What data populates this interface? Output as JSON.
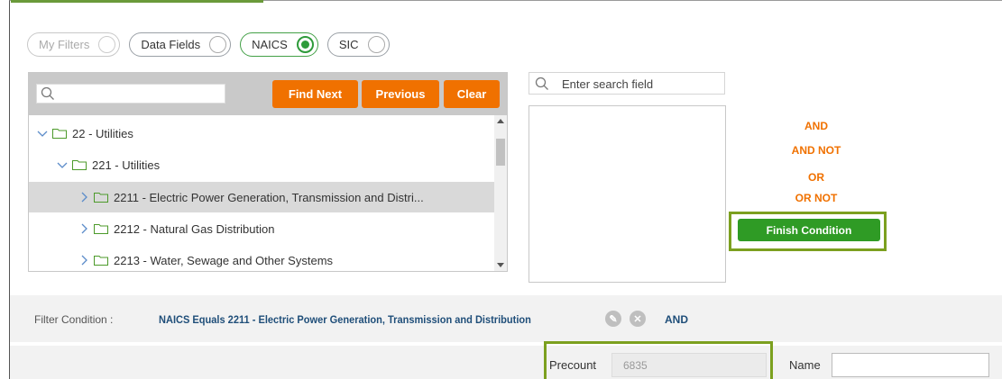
{
  "filter_tabs": [
    {
      "label": "My Filters",
      "state": "disabled"
    },
    {
      "label": "Data Fields",
      "state": "unselected"
    },
    {
      "label": "NAICS",
      "state": "selected"
    },
    {
      "label": "SIC",
      "state": "unselected"
    }
  ],
  "tree_toolbar": {
    "search_value": "",
    "find_next_label": "Find Next",
    "previous_label": "Previous",
    "clear_label": "Clear"
  },
  "tree": [
    {
      "label": "22 - Utilities",
      "expanded": true,
      "level": 0
    },
    {
      "label": "221 - Utilities",
      "expanded": true,
      "level": 1
    },
    {
      "label": "2211 - Electric Power Generation, Transmission and Distri...",
      "expanded": false,
      "level": 2,
      "selected": true
    },
    {
      "label": "2212 - Natural Gas Distribution",
      "expanded": false,
      "level": 2
    },
    {
      "label": "2213 - Water, Sewage and Other Systems",
      "expanded": false,
      "level": 2
    }
  ],
  "field_search": {
    "placeholder": "Enter search field"
  },
  "operators": [
    "AND",
    "AND NOT",
    "OR",
    "OR NOT"
  ],
  "finish_condition_label": "Finish Condition",
  "condition": {
    "label": "Filter Condition :",
    "prefix": "NAICS Equals 2211",
    "text": " - Electric Power Generation, Transmission and Distribution",
    "connector": "AND"
  },
  "precount": {
    "label": "Precount",
    "value": "6835"
  },
  "name_field": {
    "label": "Name",
    "value": ""
  },
  "colors": {
    "orange": "#f07100",
    "green": "#2f9b25",
    "highlight": "#7ca01f",
    "condition_text": "#1f4e79"
  }
}
